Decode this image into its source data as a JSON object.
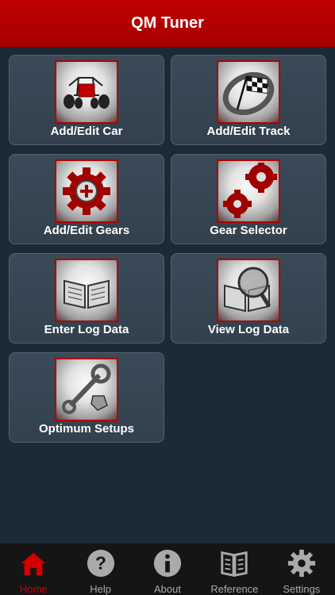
{
  "app": {
    "title": "QM Tuner"
  },
  "tiles": [
    {
      "label": "Add/Edit Car",
      "icon": "race-car-icon"
    },
    {
      "label": "Add/Edit Track",
      "icon": "checkered-flag-icon"
    },
    {
      "label": "Add/Edit Gears",
      "icon": "gear-plus-icon"
    },
    {
      "label": "Gear Selector",
      "icon": "gears-icon"
    },
    {
      "label": "Enter Log Data",
      "icon": "open-book-icon"
    },
    {
      "label": "View Log Data",
      "icon": "book-magnifier-icon"
    },
    {
      "label": "Optimum Setups",
      "icon": "wrench-icon"
    }
  ],
  "tabs": [
    {
      "label": "Home",
      "icon": "home-icon",
      "active": true
    },
    {
      "label": "Help",
      "icon": "help-icon",
      "active": false
    },
    {
      "label": "About",
      "icon": "info-icon",
      "active": false
    },
    {
      "label": "Reference",
      "icon": "book-icon",
      "active": false
    },
    {
      "label": "Settings",
      "icon": "gear-icon",
      "active": false
    }
  ],
  "colors": {
    "header": "#b00000",
    "background": "#1c2a35",
    "tile": "#36454f",
    "active_tab": "#d10000",
    "inactive_tab": "#aaaaaa"
  }
}
